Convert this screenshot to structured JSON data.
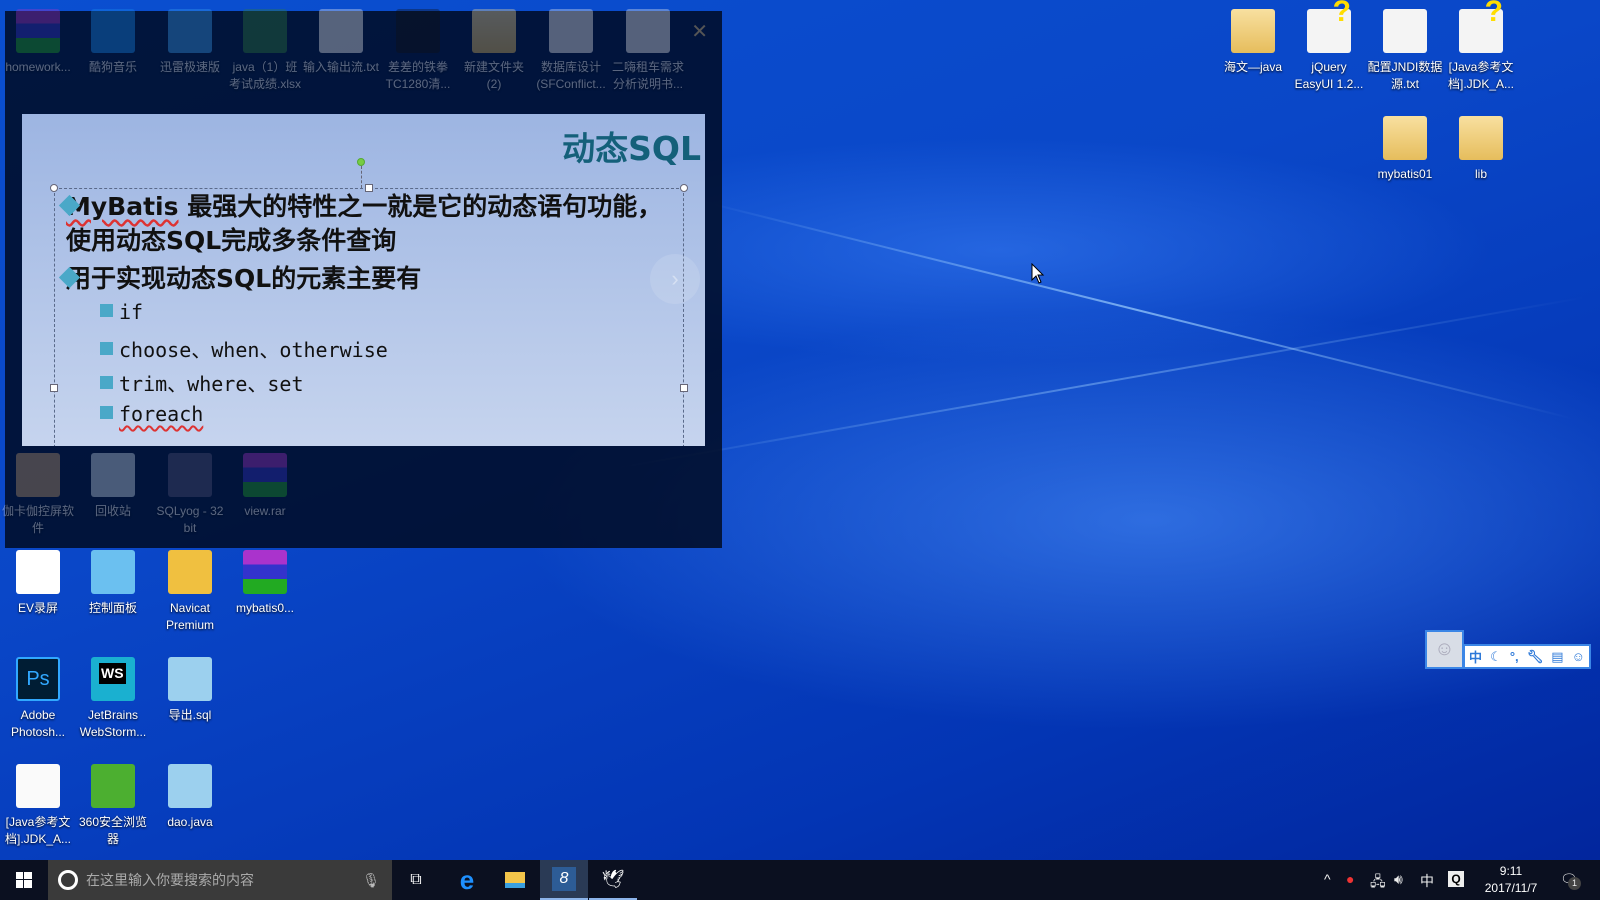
{
  "desktop": {
    "left_icons": [
      {
        "label": "homework...",
        "icon": "winrar-icon"
      },
      {
        "label": "酷狗音乐",
        "icon": "kugou-icon"
      },
      {
        "label": "迅雷极速版",
        "icon": "thunder-icon"
      },
      {
        "label": "java（1）班考试成绩.xlsx",
        "icon": "excel-icon"
      },
      {
        "label": "输入输出流.txt",
        "icon": "text-file-icon"
      },
      {
        "label": "差差的铁拳TC1280清...",
        "icon": "video-icon"
      },
      {
        "label": "新建文件夹 (2)",
        "icon": "folder-icon"
      },
      {
        "label": "数据库设计(SFConflict...",
        "icon": "word-icon"
      },
      {
        "label": "二嗨租车需求分析说明书...",
        "icon": "word-icon"
      },
      {
        "label": "伽卡伽控屏软件",
        "icon": "app-icon"
      },
      {
        "label": "回收站",
        "icon": "recycle-bin-icon"
      },
      {
        "label": "SQLyog - 32 bit",
        "icon": "sqlyog-icon"
      },
      {
        "label": "view.rar",
        "icon": "winrar-icon"
      },
      {
        "label": "EV录屏",
        "icon": "ev-icon"
      },
      {
        "label": "控制面板",
        "icon": "control-panel-icon"
      },
      {
        "label": "Navicat Premium",
        "icon": "navicat-icon"
      },
      {
        "label": "mybatis0...",
        "icon": "winrar-icon"
      },
      {
        "label": "Adobe Photosh...",
        "icon": "photoshop-icon"
      },
      {
        "label": "JetBrains WebStorm...",
        "icon": "webstorm-icon"
      },
      {
        "label": "导出.sql",
        "icon": "notepad-icon"
      },
      {
        "label": "[Java参考文档].JDK_A...",
        "icon": "blank-file-icon"
      },
      {
        "label": "360安全浏览器",
        "icon": "360-browser-icon"
      },
      {
        "label": "dao.java",
        "icon": "notepad-icon"
      }
    ],
    "right_icons": [
      {
        "label": "海文—java",
        "icon": "folder-icon"
      },
      {
        "label": "jQuery EasyUI 1.2...",
        "icon": "help-file-icon"
      },
      {
        "label": "配置JNDI数据源.txt",
        "icon": "text-file-icon"
      },
      {
        "label": "[Java参考文档].JDK_A...",
        "icon": "help-file-icon"
      },
      {
        "label": "mybatis01",
        "icon": "folder-icon"
      },
      {
        "label": "lib",
        "icon": "folder-icon"
      }
    ]
  },
  "slide": {
    "title": "动态SQL",
    "bullets": [
      {
        "pre": "MyBatis",
        "text": " 最强大的特性之一就是它的动态语句功能，使用动态SQL完成多条件查询"
      },
      {
        "text": "用于实现动态SQL的元素主要有"
      }
    ],
    "sub": [
      "if",
      "choose、when、otherwise",
      "trim、where、set",
      "foreach"
    ]
  },
  "taskbar": {
    "search_placeholder": "在这里输入你要搜索的内容",
    "ime": "中",
    "time": "9:11",
    "date": "2017/11/7",
    "notifications": "1"
  },
  "ime_bar": {
    "lang": "中",
    "punct": "°,"
  }
}
